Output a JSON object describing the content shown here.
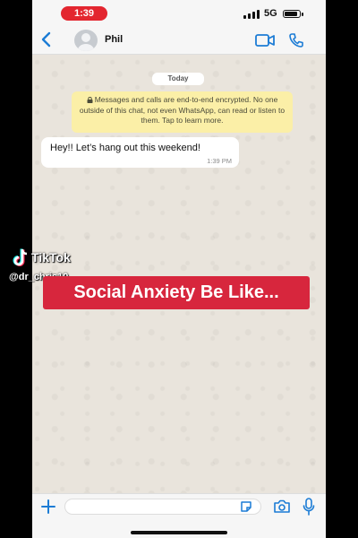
{
  "status_bar": {
    "time": "1:39",
    "network": "5G"
  },
  "header": {
    "contact_name": "Phil"
  },
  "chat": {
    "date_chip": "Today",
    "encryption_notice": "Messages and calls are end-to-end encrypted. No one outside of this chat, not even WhatsApp, can read or listen to them. Tap to learn more.",
    "messages": [
      {
        "text": "Hey!! Let’s hang out this weekend!",
        "time": "1:39 PM"
      }
    ]
  },
  "overlay": {
    "tiktok_wordmark": "TikTok",
    "tiktok_handle": "@dr_chris10",
    "caption": "Social Anxiety Be Like..."
  },
  "colors": {
    "time_pill": "#e3262f",
    "accent_blue": "#1c7cd5",
    "encryption_bg": "#fbefa7",
    "caption_bg": "#d7263d",
    "chat_bg": "#e9e4dc"
  },
  "icons": [
    "back-chevron-icon",
    "avatar-icon",
    "video-call-icon",
    "phone-call-icon",
    "lock-icon",
    "plus-icon",
    "sticker-icon",
    "camera-icon",
    "microphone-icon",
    "tiktok-logo-icon"
  ]
}
